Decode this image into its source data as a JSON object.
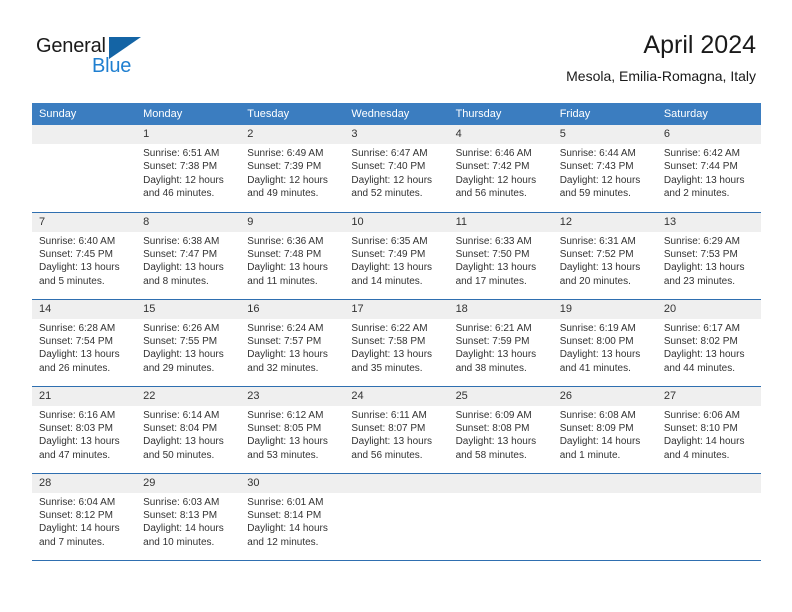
{
  "brand": {
    "name_part1": "General",
    "name_part2": "Blue",
    "logo_icon": "triangle-flag-icon",
    "accent_color": "#1f7fd0",
    "triangle_color": "#1464a5"
  },
  "header": {
    "title": "April 2024",
    "subtitle": "Mesola, Emilia-Romagna, Italy"
  },
  "theme": {
    "header_row_bg": "#3b7dc0",
    "daynum_bg": "#efefef",
    "rule_color": "#2f6fb0",
    "text_color": "#333333"
  },
  "weekdays": [
    "Sunday",
    "Monday",
    "Tuesday",
    "Wednesday",
    "Thursday",
    "Friday",
    "Saturday"
  ],
  "weeks": [
    [
      {
        "day": "",
        "lines": []
      },
      {
        "day": "1",
        "lines": [
          "Sunrise: 6:51 AM",
          "Sunset: 7:38 PM",
          "Daylight: 12 hours",
          "and 46 minutes."
        ]
      },
      {
        "day": "2",
        "lines": [
          "Sunrise: 6:49 AM",
          "Sunset: 7:39 PM",
          "Daylight: 12 hours",
          "and 49 minutes."
        ]
      },
      {
        "day": "3",
        "lines": [
          "Sunrise: 6:47 AM",
          "Sunset: 7:40 PM",
          "Daylight: 12 hours",
          "and 52 minutes."
        ]
      },
      {
        "day": "4",
        "lines": [
          "Sunrise: 6:46 AM",
          "Sunset: 7:42 PM",
          "Daylight: 12 hours",
          "and 56 minutes."
        ]
      },
      {
        "day": "5",
        "lines": [
          "Sunrise: 6:44 AM",
          "Sunset: 7:43 PM",
          "Daylight: 12 hours",
          "and 59 minutes."
        ]
      },
      {
        "day": "6",
        "lines": [
          "Sunrise: 6:42 AM",
          "Sunset: 7:44 PM",
          "Daylight: 13 hours",
          "and 2 minutes."
        ]
      }
    ],
    [
      {
        "day": "7",
        "lines": [
          "Sunrise: 6:40 AM",
          "Sunset: 7:45 PM",
          "Daylight: 13 hours",
          "and 5 minutes."
        ]
      },
      {
        "day": "8",
        "lines": [
          "Sunrise: 6:38 AM",
          "Sunset: 7:47 PM",
          "Daylight: 13 hours",
          "and 8 minutes."
        ]
      },
      {
        "day": "9",
        "lines": [
          "Sunrise: 6:36 AM",
          "Sunset: 7:48 PM",
          "Daylight: 13 hours",
          "and 11 minutes."
        ]
      },
      {
        "day": "10",
        "lines": [
          "Sunrise: 6:35 AM",
          "Sunset: 7:49 PM",
          "Daylight: 13 hours",
          "and 14 minutes."
        ]
      },
      {
        "day": "11",
        "lines": [
          "Sunrise: 6:33 AM",
          "Sunset: 7:50 PM",
          "Daylight: 13 hours",
          "and 17 minutes."
        ]
      },
      {
        "day": "12",
        "lines": [
          "Sunrise: 6:31 AM",
          "Sunset: 7:52 PM",
          "Daylight: 13 hours",
          "and 20 minutes."
        ]
      },
      {
        "day": "13",
        "lines": [
          "Sunrise: 6:29 AM",
          "Sunset: 7:53 PM",
          "Daylight: 13 hours",
          "and 23 minutes."
        ]
      }
    ],
    [
      {
        "day": "14",
        "lines": [
          "Sunrise: 6:28 AM",
          "Sunset: 7:54 PM",
          "Daylight: 13 hours",
          "and 26 minutes."
        ]
      },
      {
        "day": "15",
        "lines": [
          "Sunrise: 6:26 AM",
          "Sunset: 7:55 PM",
          "Daylight: 13 hours",
          "and 29 minutes."
        ]
      },
      {
        "day": "16",
        "lines": [
          "Sunrise: 6:24 AM",
          "Sunset: 7:57 PM",
          "Daylight: 13 hours",
          "and 32 minutes."
        ]
      },
      {
        "day": "17",
        "lines": [
          "Sunrise: 6:22 AM",
          "Sunset: 7:58 PM",
          "Daylight: 13 hours",
          "and 35 minutes."
        ]
      },
      {
        "day": "18",
        "lines": [
          "Sunrise: 6:21 AM",
          "Sunset: 7:59 PM",
          "Daylight: 13 hours",
          "and 38 minutes."
        ]
      },
      {
        "day": "19",
        "lines": [
          "Sunrise: 6:19 AM",
          "Sunset: 8:00 PM",
          "Daylight: 13 hours",
          "and 41 minutes."
        ]
      },
      {
        "day": "20",
        "lines": [
          "Sunrise: 6:17 AM",
          "Sunset: 8:02 PM",
          "Daylight: 13 hours",
          "and 44 minutes."
        ]
      }
    ],
    [
      {
        "day": "21",
        "lines": [
          "Sunrise: 6:16 AM",
          "Sunset: 8:03 PM",
          "Daylight: 13 hours",
          "and 47 minutes."
        ]
      },
      {
        "day": "22",
        "lines": [
          "Sunrise: 6:14 AM",
          "Sunset: 8:04 PM",
          "Daylight: 13 hours",
          "and 50 minutes."
        ]
      },
      {
        "day": "23",
        "lines": [
          "Sunrise: 6:12 AM",
          "Sunset: 8:05 PM",
          "Daylight: 13 hours",
          "and 53 minutes."
        ]
      },
      {
        "day": "24",
        "lines": [
          "Sunrise: 6:11 AM",
          "Sunset: 8:07 PM",
          "Daylight: 13 hours",
          "and 56 minutes."
        ]
      },
      {
        "day": "25",
        "lines": [
          "Sunrise: 6:09 AM",
          "Sunset: 8:08 PM",
          "Daylight: 13 hours",
          "and 58 minutes."
        ]
      },
      {
        "day": "26",
        "lines": [
          "Sunrise: 6:08 AM",
          "Sunset: 8:09 PM",
          "Daylight: 14 hours",
          "and 1 minute."
        ]
      },
      {
        "day": "27",
        "lines": [
          "Sunrise: 6:06 AM",
          "Sunset: 8:10 PM",
          "Daylight: 14 hours",
          "and 4 minutes."
        ]
      }
    ],
    [
      {
        "day": "28",
        "lines": [
          "Sunrise: 6:04 AM",
          "Sunset: 8:12 PM",
          "Daylight: 14 hours",
          "and 7 minutes."
        ]
      },
      {
        "day": "29",
        "lines": [
          "Sunrise: 6:03 AM",
          "Sunset: 8:13 PM",
          "Daylight: 14 hours",
          "and 10 minutes."
        ]
      },
      {
        "day": "30",
        "lines": [
          "Sunrise: 6:01 AM",
          "Sunset: 8:14 PM",
          "Daylight: 14 hours",
          "and 12 minutes."
        ]
      },
      {
        "day": "",
        "lines": []
      },
      {
        "day": "",
        "lines": []
      },
      {
        "day": "",
        "lines": []
      },
      {
        "day": "",
        "lines": []
      }
    ]
  ]
}
